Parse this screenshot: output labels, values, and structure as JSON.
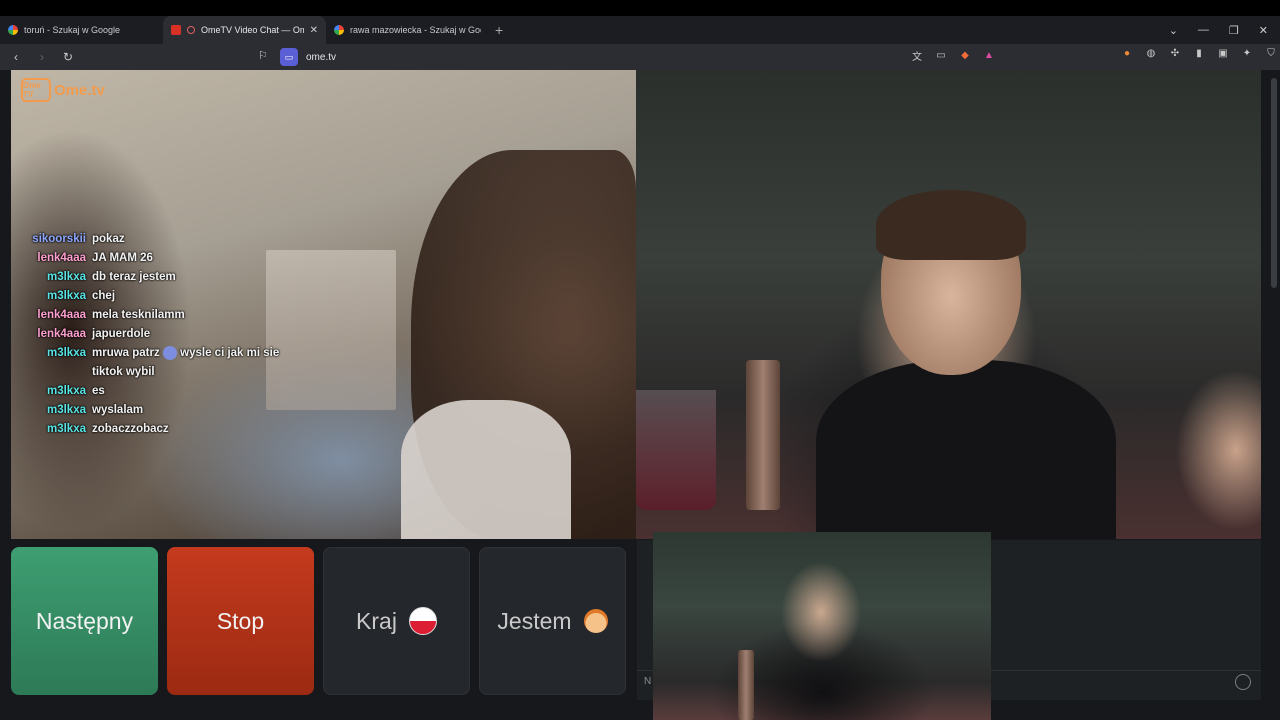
{
  "browser": {
    "tabs": [
      {
        "title": "toruń - Szukaj w Google",
        "active": false,
        "favicon": "google-icon"
      },
      {
        "title": "OmeTV Video Chat — Omegle",
        "active": true,
        "favicon": "ometv-icon"
      },
      {
        "title": "rawa mazowiecka - Szukaj w Google",
        "active": false,
        "favicon": "google-icon"
      }
    ],
    "new_tab": "+",
    "url": "ome.tv"
  },
  "site": {
    "logo_box": "Ome TV",
    "logo_text": "Ome.tv"
  },
  "chat": [
    {
      "user": "sikoorskii",
      "text": "pokaz",
      "color": "#8ea7ff"
    },
    {
      "user": "lenk4aaa",
      "text": "JA MAM 26",
      "color": "#ff9fd0"
    },
    {
      "user": "m3lkxa",
      "text": "db teraz jestem",
      "color": "#58e4e4"
    },
    {
      "user": "m3lkxa",
      "text": "chej",
      "color": "#58e4e4"
    },
    {
      "user": "lenk4aaa",
      "text": "mela tesknilamm",
      "color": "#ff9fd0"
    },
    {
      "user": "lenk4aaa",
      "text": "japuerdole",
      "color": "#ff9fd0"
    },
    {
      "user": "m3lkxa",
      "text": "mruwa patrz",
      "text2": "wysle ci jak mi sie tiktok wybil",
      "color": "#58e4e4"
    },
    {
      "user": "m3lkxa",
      "text": "es",
      "color": "#58e4e4"
    },
    {
      "user": "m3lkxa",
      "text": "wyslalam",
      "color": "#58e4e4"
    },
    {
      "user": "m3lkxa",
      "text": "zobaczzobacz",
      "color": "#58e4e4"
    }
  ],
  "controls": {
    "next_label": "Następny",
    "stop_label": "Stop",
    "country_label": "Kraj",
    "gender_label": "Jestem",
    "country_flag": "poland-flag-icon",
    "gender_icon": "boy-face-icon"
  },
  "chat_input": {
    "placeholder_partial": "N"
  },
  "colors": {
    "next": "#3e9e72",
    "stop": "#c43a1e",
    "logo": "#f39b4d"
  }
}
